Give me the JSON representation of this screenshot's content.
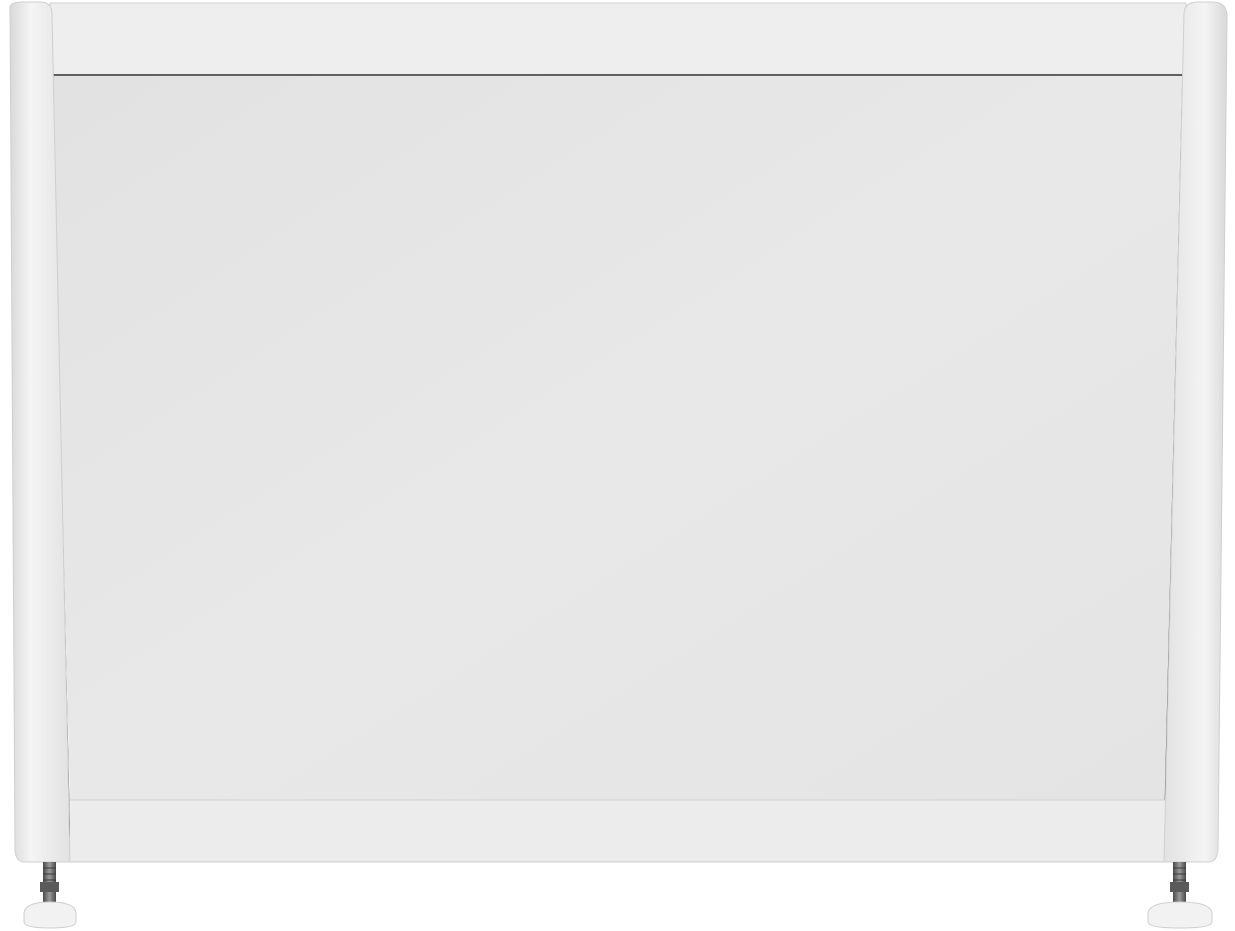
{
  "image": {
    "subject": "bath-side-panel",
    "background_color": "#ffffff",
    "panel_color": "#e6e6e6",
    "post_color": "#ececec",
    "edge_color": "#2f2f2f",
    "foot_color": "#f2f2f2",
    "bolt_color": "#6a6a6a"
  }
}
